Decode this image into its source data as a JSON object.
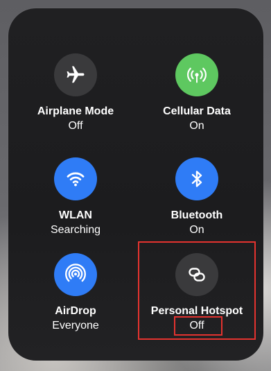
{
  "controls": [
    {
      "id": "airplane",
      "title": "Airplane Mode",
      "status": "Off",
      "icon": "airplane-icon",
      "color": "#3a3a3c"
    },
    {
      "id": "cellular",
      "title": "Cellular Data",
      "status": "On",
      "icon": "antenna-icon",
      "color": "#5ec860"
    },
    {
      "id": "wlan",
      "title": "WLAN",
      "status": "Searching",
      "icon": "wifi-icon",
      "color": "#2f7cf6"
    },
    {
      "id": "bluetooth",
      "title": "Bluetooth",
      "status": "On",
      "icon": "bluetooth-icon",
      "color": "#2f7cf6"
    },
    {
      "id": "airdrop",
      "title": "AirDrop",
      "status": "Everyone",
      "icon": "airdrop-icon",
      "color": "#2f7cf6"
    },
    {
      "id": "hotspot",
      "title": "Personal Hotspot",
      "status": "Off",
      "icon": "hotspot-link-icon",
      "color": "#3a3a3c"
    }
  ],
  "annotations": {
    "highlight_color": "#e5332f"
  }
}
